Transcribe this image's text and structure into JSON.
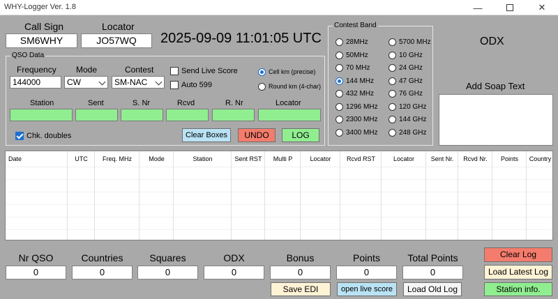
{
  "window": {
    "title": "WHY-Logger  Ver. 1.8"
  },
  "callsign": {
    "label": "Call Sign",
    "value": "SM6WHY"
  },
  "locator_top": {
    "label": "Locator",
    "value": "JO57WQ"
  },
  "clock": "2025-09-09 11:01:05 UTC",
  "qso_data": {
    "group_title": "QSO Data",
    "frequency": {
      "label": "Frequency",
      "value": "144000"
    },
    "mode": {
      "label": "Mode",
      "value": "CW"
    },
    "contest": {
      "label": "Contest",
      "value": "SM-NAC"
    },
    "send_live_score": {
      "label": "Send Live Score",
      "checked": false
    },
    "auto_599": {
      "label": "Auto 599",
      "checked": false
    },
    "dist_options": [
      {
        "label": "Cell km (precise)",
        "checked": true
      },
      {
        "label": "Round km (4-char)",
        "checked": false
      }
    ],
    "fields": [
      {
        "label": "Station"
      },
      {
        "label": "Sent"
      },
      {
        "label": "S. Nr"
      },
      {
        "label": "Rcvd"
      },
      {
        "label": "R. Nr"
      },
      {
        "label": "Locator"
      }
    ],
    "chk_doubles": {
      "label": "Chk. doubles",
      "checked": true
    },
    "buttons": {
      "clear": "Clear Boxes",
      "undo": "UNDO",
      "log": "LOG"
    }
  },
  "contest_band": {
    "title": "Contest Band",
    "left": [
      "28MHz",
      "50MHz",
      "70 MHz",
      "144 MHz",
      "432 MHz",
      "1296 MHz",
      "2300 MHz",
      "3400 MHz"
    ],
    "right": [
      "5700 MHz",
      "10 GHz",
      "24 GHz",
      "47 GHz",
      "76 GHz",
      "120 GHz",
      "144 GHz",
      "248 GHz"
    ],
    "selected": "144 MHz"
  },
  "odx_label": "ODX",
  "soap": {
    "label": "Add Soap Text",
    "value": ""
  },
  "table": {
    "headers": [
      "Date",
      "UTC",
      "Freq. MHz",
      "Mode",
      "Station",
      "Sent RST",
      "Multi P",
      "Locator",
      "Rcvd RST",
      "Locator",
      "Sent Nr.",
      "Rcvd Nr.",
      "Points",
      "Country"
    ]
  },
  "stats": [
    {
      "label": "Nr QSO",
      "value": "0"
    },
    {
      "label": "Countries",
      "value": "0"
    },
    {
      "label": "Squares",
      "value": "0"
    },
    {
      "label": "ODX",
      "value": "0"
    },
    {
      "label": "Bonus",
      "value": "0"
    },
    {
      "label": "Points",
      "value": "0"
    },
    {
      "label": "Total Points",
      "value": "0"
    }
  ],
  "bottom_buttons": {
    "save_edi": "Save EDI",
    "open_live": "open live score",
    "load_old": "Load Old Log",
    "clear_log": "Clear Log",
    "load_latest": "Load Latest Log",
    "station_info": "Station info."
  },
  "colors": {
    "background": "#a9a9a9",
    "field_green": "#90ee90",
    "undo_red": "#f47c6c",
    "log_green": "#90ee90",
    "clear_blue": "#b9e3f4",
    "radio_accent": "#1f6fd1"
  }
}
